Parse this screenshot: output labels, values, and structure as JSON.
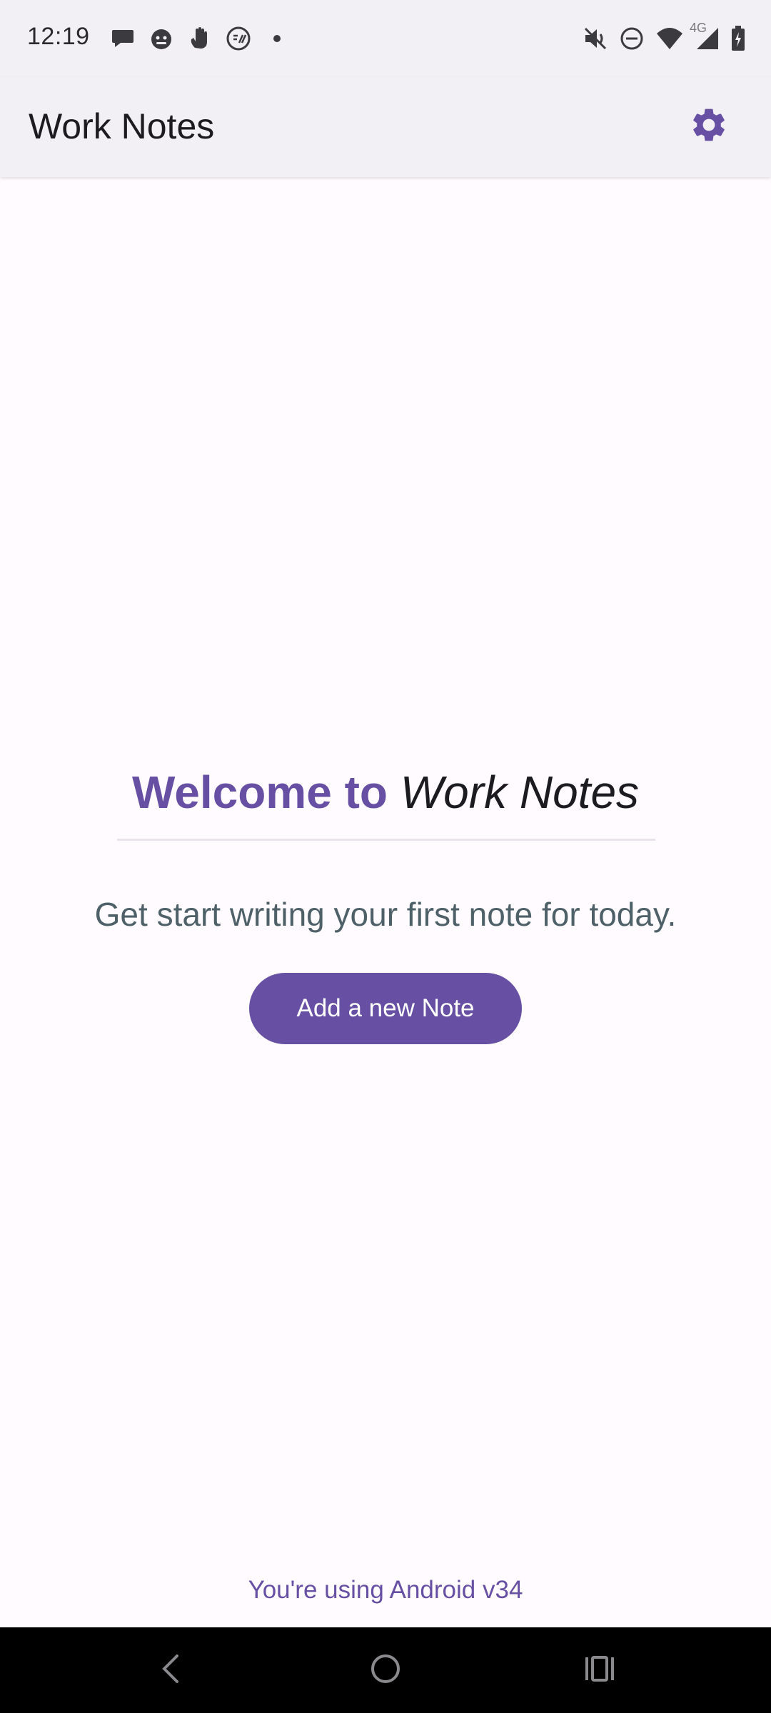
{
  "status_bar": {
    "time": "12:19",
    "network_label": "4G",
    "notification_icons": [
      "chat-bubble-icon",
      "cat-face-icon",
      "hand-icon",
      "app-circle-icon",
      "dot-icon"
    ],
    "system_icons": [
      "mute-icon",
      "do-not-disturb-icon",
      "wifi-icon",
      "signal-icon",
      "battery-icon"
    ]
  },
  "app_bar": {
    "title": "Work Notes",
    "settings_icon": "gear-icon"
  },
  "content": {
    "welcome_prefix": "Welcome to",
    "welcome_app_name": "Work Notes",
    "subtitle": "Get start writing your first note for today.",
    "add_button_label": "Add a new Note",
    "version_text": "You're using Android v34"
  },
  "navigation": {
    "back_icon": "back-chevron-icon",
    "home_icon": "home-circle-icon",
    "recents_icon": "recents-icon"
  },
  "colors": {
    "accent": "#6750a4",
    "background": "#fffbfe",
    "app_bar": "#f2eff5",
    "subtitle_text": "#4e6068",
    "nav_bar": "#000000"
  }
}
